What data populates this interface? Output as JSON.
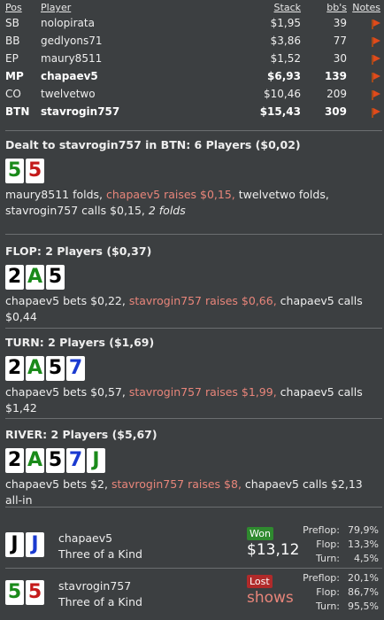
{
  "players_table": {
    "headers": {
      "pos": "Pos",
      "player": "Player",
      "stack": "Stack",
      "bbs": "bb's",
      "notes": "Notes"
    },
    "rows": [
      {
        "pos": "SB",
        "player": "nolopirata",
        "stack": "$1,95",
        "bbs": "39",
        "bold": false
      },
      {
        "pos": "BB",
        "player": "gedlyons71",
        "stack": "$3,86",
        "bbs": "77",
        "bold": false
      },
      {
        "pos": "EP",
        "player": "maury8511",
        "stack": "$1,52",
        "bbs": "30",
        "bold": false
      },
      {
        "pos": "MP",
        "player": "chapaev5",
        "stack": "$6,93",
        "bbs": "139",
        "bold": true
      },
      {
        "pos": "CO",
        "player": "twelvetwo",
        "stack": "$10,46",
        "bbs": "209",
        "bold": false
      },
      {
        "pos": "BTN",
        "player": "stavrogin757",
        "stack": "$15,43",
        "bbs": "309",
        "bold": true
      }
    ],
    "note_icon": "red-flag-icon"
  },
  "preflop": {
    "heading": "Dealt to stavrogin757 in BTN: 6 Players ($0,02)",
    "cards": [
      {
        "rank": "5",
        "suit": "clubs"
      },
      {
        "rank": "5",
        "suit": "hearts"
      }
    ],
    "action_parts": [
      {
        "text": "maury8511 folds, ",
        "style": "normal"
      },
      {
        "text": "chapaev5 raises $0,15, ",
        "style": "hero"
      },
      {
        "text": "twelvetwo folds,",
        "style": "normal"
      },
      {
        "text": " stavrogin757 calls $0,15, ",
        "style": "normal"
      },
      {
        "text": "2 folds",
        "style": "italic"
      }
    ]
  },
  "flop": {
    "heading": "FLOP: 2 Players ($0,37)",
    "cards": [
      {
        "rank": "2",
        "suit": "spades"
      },
      {
        "rank": "A",
        "suit": "clubs"
      },
      {
        "rank": "5",
        "suit": "spades"
      }
    ],
    "action_parts": [
      {
        "text": "chapaev5 bets $0,22, ",
        "style": "normal"
      },
      {
        "text": "stavrogin757 raises $0,66, ",
        "style": "hero"
      },
      {
        "text": "chapaev5 calls $0,44",
        "style": "normal"
      }
    ]
  },
  "turn": {
    "heading": "TURN: 2 Players ($1,69)",
    "cards": [
      {
        "rank": "2",
        "suit": "spades"
      },
      {
        "rank": "A",
        "suit": "clubs"
      },
      {
        "rank": "5",
        "suit": "spades"
      },
      {
        "rank": "7",
        "suit": "diamonds"
      }
    ],
    "action_parts": [
      {
        "text": "chapaev5 bets $0,57, ",
        "style": "normal"
      },
      {
        "text": "stavrogin757 raises $1,99, ",
        "style": "hero"
      },
      {
        "text": "chapaev5 calls $1,42",
        "style": "normal"
      }
    ]
  },
  "river": {
    "heading": "RIVER: 2 Players ($5,67)",
    "cards": [
      {
        "rank": "2",
        "suit": "spades"
      },
      {
        "rank": "A",
        "suit": "clubs"
      },
      {
        "rank": "5",
        "suit": "spades"
      },
      {
        "rank": "7",
        "suit": "diamonds"
      },
      {
        "rank": "J",
        "suit": "clubs"
      }
    ],
    "action_parts": [
      {
        "text": "chapaev5 bets $2, ",
        "style": "normal"
      },
      {
        "text": "stavrogin757 raises $8, ",
        "style": "hero"
      },
      {
        "text": "chapaev5 calls $2,13 all-in",
        "style": "normal"
      }
    ]
  },
  "results": [
    {
      "cards": [
        {
          "rank": "J",
          "suit": "spades"
        },
        {
          "rank": "J",
          "suit": "diamonds"
        }
      ],
      "player": "chapaev5",
      "hand": "Three of a Kind",
      "badge": "Won",
      "badge_type": "won",
      "amount": "$13,12",
      "amount_style": "normal",
      "stats": [
        {
          "label": "Preflop:",
          "value": "79,9%"
        },
        {
          "label": "Flop:",
          "value": "13,3%"
        },
        {
          "label": "Turn:",
          "value": "4,5%"
        }
      ]
    },
    {
      "cards": [
        {
          "rank": "5",
          "suit": "clubs"
        },
        {
          "rank": "5",
          "suit": "hearts"
        }
      ],
      "player": "stavrogin757",
      "hand": "Three of a Kind",
      "badge": "Lost",
      "badge_type": "lost",
      "amount": "shows",
      "amount_style": "shows",
      "stats": [
        {
          "label": "Preflop:",
          "value": "20,1%"
        },
        {
          "label": "Flop:",
          "value": "86,7%"
        },
        {
          "label": "Turn:",
          "value": "95,5%"
        }
      ]
    }
  ],
  "suit_colors": {
    "spades": "#000000",
    "clubs": "#1a8a1a",
    "hearts": "#c41a1a",
    "diamonds": "#1a3ad0"
  }
}
